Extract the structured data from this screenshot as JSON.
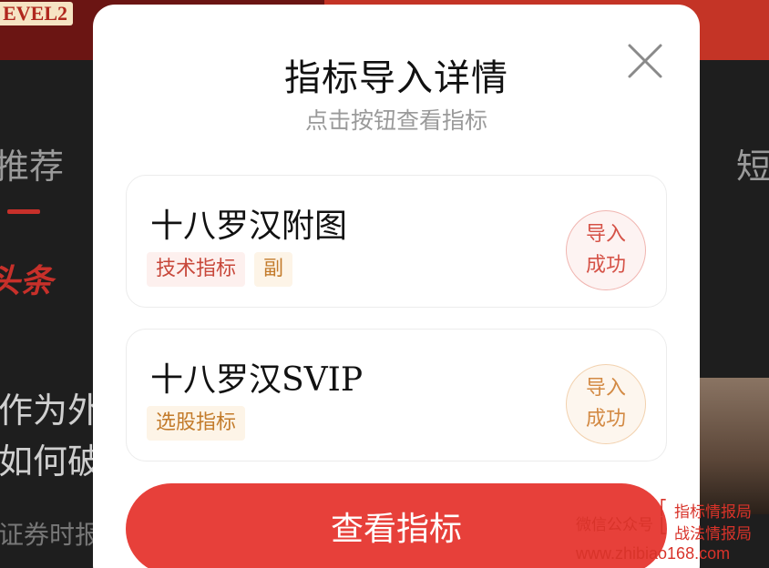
{
  "background": {
    "level_badge": "EVEL2",
    "tab_recommend": "推荐",
    "tab_short": "短",
    "headline_badge": "头条",
    "line1": "作为外",
    "line2": "如何破",
    "line3": "证券时报"
  },
  "modal": {
    "title": "指标导入详情",
    "subtitle": "点击按钮查看指标",
    "cards": [
      {
        "name": "十八罗汉附图",
        "tags": [
          "技术指标",
          "副"
        ],
        "status_line1": "导入",
        "status_line2": "成功"
      },
      {
        "name": "十八罗汉SVIP",
        "tags": [
          "选股指标"
        ],
        "status_line1": "导入",
        "status_line2": "成功"
      }
    ],
    "button_label": "查看指标"
  },
  "watermark": {
    "wechat_label": "微信公众号",
    "name1": "指标情报局",
    "name2": "战法情报局",
    "url": "www.zhibiao168.com"
  },
  "colors": {
    "accent": "#e7403a",
    "tag_red": "#c8483b",
    "tag_orange": "#c37b2b"
  }
}
